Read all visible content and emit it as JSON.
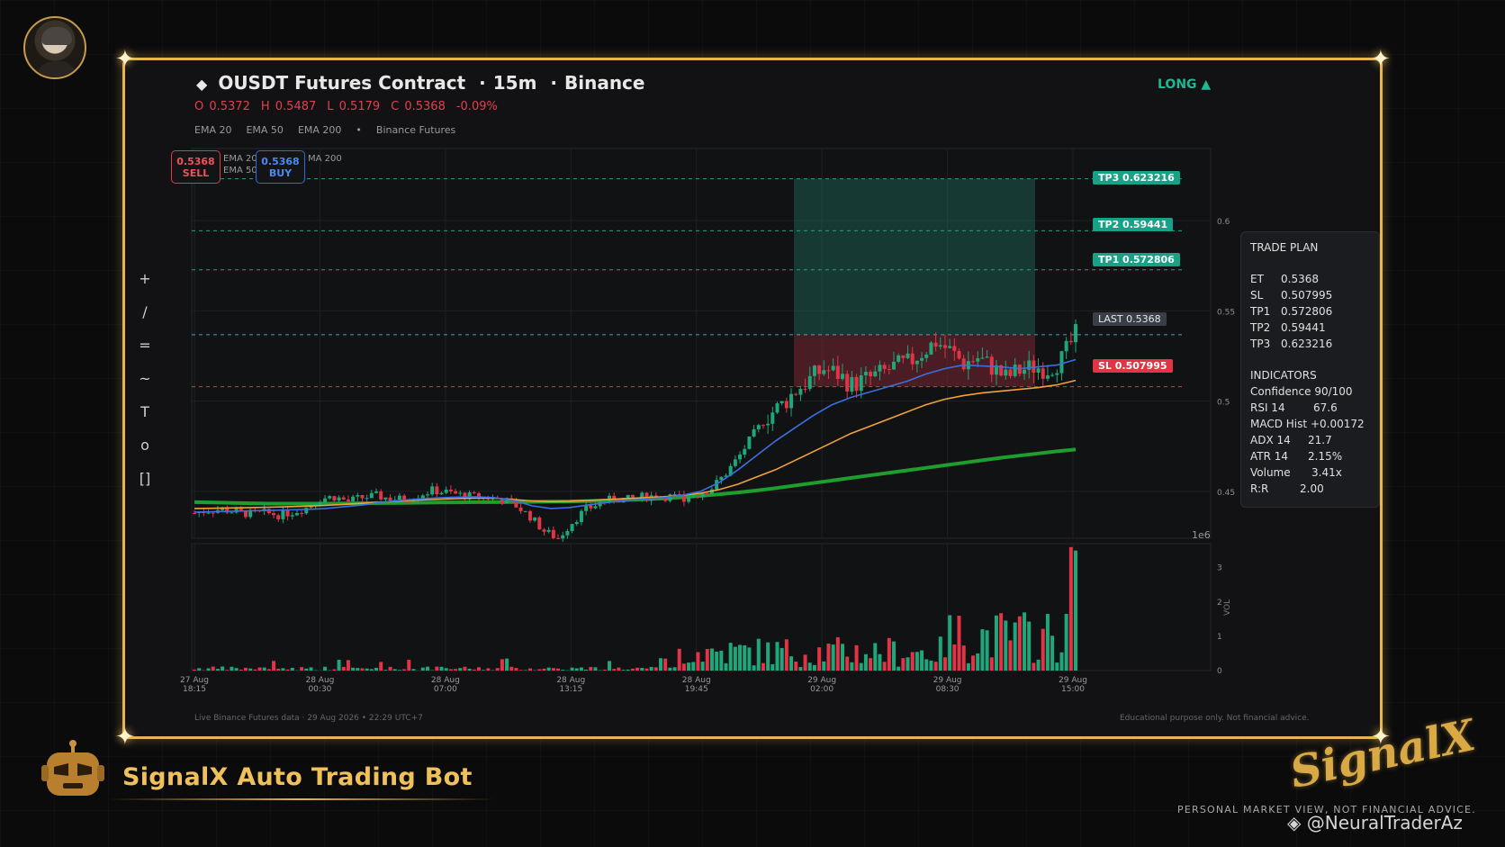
{
  "header": {
    "title": "OUSDT Futures Contract",
    "timeframe": "15m",
    "exchange": "Binance",
    "separator": "·",
    "side": "LONG ▲",
    "ohlc": {
      "open": "O 0.5372",
      "high": "H 0.5487",
      "low": "L 0.5179",
      "close": "C 0.5368",
      "change": "-0.09%"
    },
    "legend": [
      "EMA 20",
      "EMA 50",
      "EMA 200",
      "•",
      "Binance Futures"
    ]
  },
  "toolbar": {
    "items": [
      "+",
      "/",
      "=",
      "~",
      "T",
      "o",
      "[]"
    ]
  },
  "order_boxes": {
    "sell_price": "0.5368",
    "sell_label": "SELL",
    "buy_price": "0.5368",
    "buy_label": "BUY",
    "mini_legend_1": [
      "EMA 20",
      "EMA 50"
    ],
    "mini_legend_2": "MA 200"
  },
  "levels": {
    "tp3": "TP3  0.623216",
    "tp2": "TP2  0.59441",
    "tp1": "TP1  0.572806",
    "last": "LAST  0.5368",
    "sl": "SL  0.507995"
  },
  "trade_plan": {
    "title": "TRADE PLAN",
    "rows": [
      {
        "k": "ET",
        "v": "0.5368"
      },
      {
        "k": "SL",
        "v": "0.507995"
      },
      {
        "k": "TP1",
        "v": "0.572806"
      },
      {
        "k": "TP2",
        "v": "0.59441"
      },
      {
        "k": "TP3",
        "v": "0.623216"
      }
    ],
    "indicators_title": "INDICATORS",
    "indicators": [
      {
        "k": "Confidence",
        "v": "90/100"
      },
      {
        "k": "RSI 14",
        "v": "67.6"
      },
      {
        "k": "MACD Hist",
        "v": "+0.00172"
      },
      {
        "k": "ADX 14",
        "v": "21.7"
      },
      {
        "k": "ATR 14",
        "v": "2.15%"
      },
      {
        "k": "Volume",
        "v": "3.41x"
      },
      {
        "k": "R:R",
        "v": "2.00"
      }
    ]
  },
  "footer": {
    "left": "Live Binance Futures data  ·  29 Aug 2026 • 22:29 UTC+7",
    "right": "Educational purpose only. Not financial advice."
  },
  "branding": {
    "bot_title": "SignalX Auto Trading Bot",
    "logo_text": "SignalX",
    "disclaimer": "PERSONAL MARKET VIEW, NOT FINANCIAL ADVICE.",
    "handle": "@NeuralTraderAz"
  },
  "colors": {
    "accent_gold": "#e6b552",
    "bull": "#1fa67a",
    "bear": "#e23446",
    "ema20": "#3b6fe0",
    "ema50": "#f2a23a",
    "ema200": "#1e9e2e"
  },
  "chart_data": {
    "type": "candlestick",
    "y_axis": {
      "ticks": [
        "0.45",
        "0.5",
        "0.55",
        "0.6"
      ],
      "range": [
        0.424,
        0.64
      ],
      "offset_label": "1e6"
    },
    "x_axis": {
      "ticks": [
        "27 Aug\n18:15",
        "28 Aug\n00:30",
        "28 Aug\n07:00",
        "28 Aug\n13:15",
        "28 Aug\n19:45",
        "29 Aug\n02:00",
        "29 Aug\n08:30",
        "29 Aug\n15:00"
      ]
    },
    "volume_axis": {
      "label": "VOL",
      "ticks": [
        "0",
        "1",
        "2",
        "3"
      ],
      "range": [
        0,
        3.7
      ]
    },
    "levels": {
      "tp3": 0.623216,
      "tp2": 0.59441,
      "tp1": 0.572806,
      "last": 0.5368,
      "sl": 0.507995
    },
    "trade_zone": {
      "entry": 0.5368,
      "target": 0.623216,
      "stop": 0.507995
    },
    "close_path": [
      0.438,
      0.4395,
      0.44,
      0.4385,
      0.4375,
      0.438,
      0.437,
      0.4385,
      0.441,
      0.446,
      0.447,
      0.4445,
      0.4465,
      0.4475,
      0.446,
      0.4455,
      0.448,
      0.4505,
      0.4495,
      0.448,
      0.447,
      0.4465,
      0.4455,
      0.442,
      0.436,
      0.428,
      0.424,
      0.433,
      0.44,
      0.4435,
      0.446,
      0.4455,
      0.447,
      0.4475,
      0.447,
      0.4465,
      0.4485,
      0.452,
      0.46,
      0.47,
      0.482,
      0.492,
      0.498,
      0.506,
      0.512,
      0.518,
      0.515,
      0.509,
      0.512,
      0.515,
      0.519,
      0.521,
      0.527,
      0.533,
      0.528,
      0.521,
      0.524,
      0.519,
      0.513,
      0.517,
      0.519,
      0.518,
      0.523,
      0.5368
    ],
    "ema20": [
      0.4385,
      0.4387,
      0.4389,
      0.4392,
      0.4394,
      0.4397,
      0.44,
      0.4405,
      0.4415,
      0.4425,
      0.444,
      0.445,
      0.4458,
      0.4464,
      0.4468,
      0.447,
      0.4465,
      0.445,
      0.442,
      0.4405,
      0.441,
      0.4425,
      0.4438,
      0.4448,
      0.4458,
      0.4465,
      0.4478,
      0.45,
      0.455,
      0.462,
      0.47,
      0.478,
      0.485,
      0.492,
      0.498,
      0.502,
      0.505,
      0.508,
      0.511,
      0.515,
      0.518,
      0.52,
      0.5195,
      0.519,
      0.518,
      0.519,
      0.52,
      0.523
    ],
    "ema50": [
      0.4405,
      0.4406,
      0.4408,
      0.441,
      0.4412,
      0.4415,
      0.4418,
      0.4422,
      0.4428,
      0.4434,
      0.444,
      0.4446,
      0.4452,
      0.4456,
      0.446,
      0.4462,
      0.4462,
      0.4455,
      0.4447,
      0.4443,
      0.4445,
      0.445,
      0.4455,
      0.446,
      0.4465,
      0.447,
      0.4478,
      0.449,
      0.451,
      0.454,
      0.458,
      0.462,
      0.467,
      0.472,
      0.477,
      0.482,
      0.486,
      0.49,
      0.494,
      0.498,
      0.501,
      0.503,
      0.5045,
      0.5055,
      0.5065,
      0.5075,
      0.509,
      0.5115
    ],
    "ema200": [
      0.444,
      0.4438,
      0.4436,
      0.4434,
      0.4432,
      0.4432,
      0.4432,
      0.4432,
      0.4433,
      0.4434,
      0.4435,
      0.4436,
      0.4437,
      0.4438,
      0.4439,
      0.444,
      0.444,
      0.4441,
      0.4442,
      0.4443,
      0.4444,
      0.4446,
      0.4449,
      0.4452,
      0.4456,
      0.4461,
      0.4467,
      0.4475,
      0.4484,
      0.4494,
      0.4505,
      0.4518,
      0.4532,
      0.4546,
      0.456,
      0.4574,
      0.4588,
      0.4602,
      0.4616,
      0.463,
      0.4644,
      0.4658,
      0.4672,
      0.4686,
      0.4698,
      0.471,
      0.4722,
      0.4732
    ]
  }
}
